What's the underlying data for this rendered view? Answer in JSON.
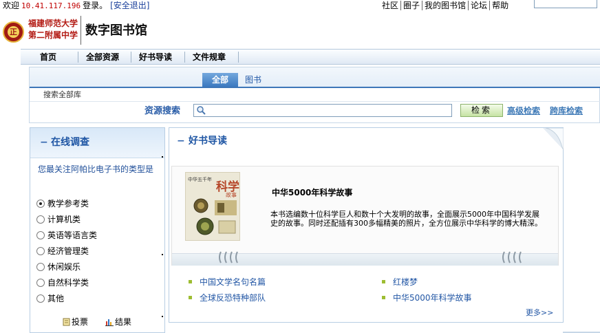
{
  "topbar": {
    "welcome_prefix": "欢迎",
    "ip": "10.41.117.196",
    "login_suffix": "登录。",
    "logout": "[安全退出]",
    "links": [
      "社区",
      "圈子",
      "我的图书馆",
      "论坛",
      "帮助"
    ]
  },
  "header": {
    "school_line1": "福建师范大学",
    "school_line2": "第二附属中学",
    "library_title": "数字图书馆",
    "logo_char": "正"
  },
  "nav": {
    "items": [
      "首页",
      "全部资源",
      "好书导读",
      "文件规章"
    ]
  },
  "search": {
    "tabs": [
      "全部",
      "图书"
    ],
    "scope": "搜索全部库",
    "label": "资源搜索",
    "input_value": "",
    "button": "检索",
    "advanced": "高级检索",
    "cross": "跨库检索"
  },
  "survey": {
    "title": "在线调查",
    "question": "您最关注阿帕比电子书的类型是",
    "options": [
      {
        "label": "教学参考类",
        "selected": true
      },
      {
        "label": "计算机类",
        "selected": false
      },
      {
        "label": "英语等语言类",
        "selected": false
      },
      {
        "label": "经济管理类",
        "selected": false
      },
      {
        "label": "休闲娱乐",
        "selected": false
      },
      {
        "label": "自然科学类",
        "selected": false
      },
      {
        "label": "其他",
        "selected": false
      }
    ],
    "vote": "投票",
    "result": "结果"
  },
  "recommend": {
    "title": "好书导读",
    "featured": {
      "title": "中华5000年科学故事",
      "description": "本书选编数十位科学巨人和数十个大发明的故事，全面展示5000年中国科学发展史的故事。同时还配插有300多幅精美的照片，全方位展示中华科学的博大精深。",
      "cover_big": "科学",
      "cover_sub": "故事",
      "cover_small": "中华五千年"
    },
    "links": [
      "中国文学名句名篇",
      "红楼梦",
      "全球反恐特种部队",
      "中华5000年科学故事"
    ],
    "more": "更多>>"
  },
  "colors": {
    "accent": "#1f56a4",
    "school_red": "#b31b14",
    "link_blue": "#2357a5",
    "bullet_green": "#9dbd32"
  }
}
